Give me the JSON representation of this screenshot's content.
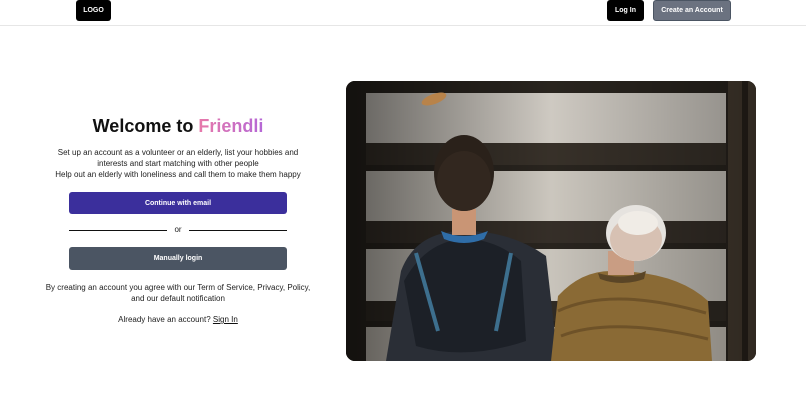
{
  "header": {
    "logo_label": "LOGO",
    "login_label": "Log In",
    "create_account_label": "Create an Account"
  },
  "hero": {
    "title_prefix": "Welcome to",
    "title_brand": "Friendli",
    "description_lines": [
      "Set up an account as a volunteer or an elderly, list your hobbies and",
      "interests and start matching with other people",
      "Help out an elderly with loneliness and call them to make them happy"
    ],
    "continue_email_label": "Continue with email",
    "or_label": "or",
    "manual_login_label": "Manually login",
    "terms_text": "By creating an account you agree with our Term of Service, Privacy, Policy, and our default notification",
    "already_account_text": "Already have an account?",
    "sign_in_label": "Sign In"
  },
  "colors": {
    "primary_button": "#3b2f9c",
    "secondary_button": "#4b5563",
    "brand_gradient_start": "#e879a9",
    "brand_gradient_end": "#b567d6"
  }
}
